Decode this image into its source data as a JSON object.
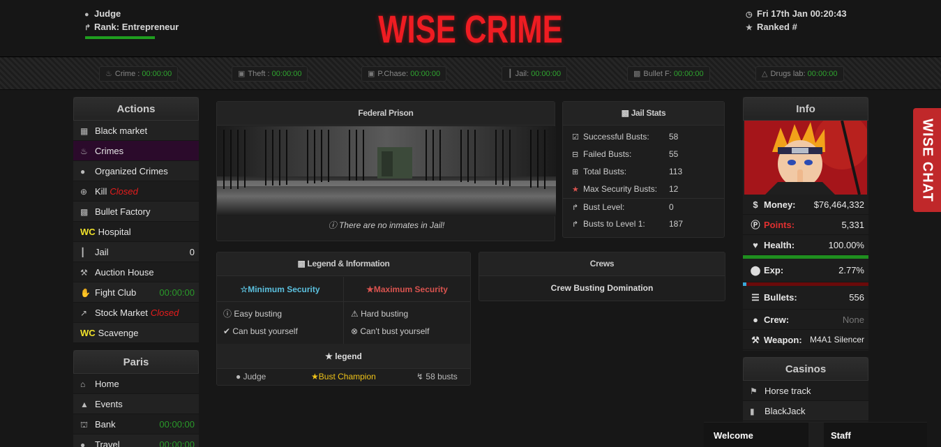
{
  "header": {
    "username": "Judge",
    "rank": "Rank: Entrepreneur",
    "logo": "WISE CRIME",
    "datetime": "Fri 17th Jan 00:20:43",
    "ranked": "Ranked #",
    "hp_fraction": 1.0,
    "logo_color": "#ef1c22"
  },
  "timers": [
    {
      "label": "Crime : ",
      "value": "00:00:00",
      "icon": "fire-icon"
    },
    {
      "label": "Theft : ",
      "value": "00:00:00",
      "icon": "car-icon"
    },
    {
      "label": "P.Chase: ",
      "value": "00:00:00",
      "icon": "car-icon"
    },
    {
      "label": "Jail: ",
      "value": "00:00:00",
      "icon": "bars-icon"
    },
    {
      "label": "Bullet F: ",
      "value": "00:00:00",
      "icon": "factory-icon"
    },
    {
      "label": "Drugs lab: ",
      "value": "00:00:00",
      "icon": "flask-icon"
    }
  ],
  "actions": {
    "title": "Actions",
    "items": [
      {
        "label": "Black market",
        "icon": "shop-icon"
      },
      {
        "label": "Crimes",
        "icon": "fire-icon",
        "active": true
      },
      {
        "label": "Organized Crimes",
        "icon": "users-icon"
      },
      {
        "label": "Kill",
        "icon": "crosshair-icon",
        "status": "Closed"
      },
      {
        "label": "Bullet Factory",
        "icon": "factory-icon"
      },
      {
        "label": "Hospital",
        "prefix": "WC"
      },
      {
        "label": "Jail",
        "icon": "bars-icon",
        "right": "0"
      },
      {
        "label": "Auction House",
        "icon": "gavel-icon"
      },
      {
        "label": "Fight Club",
        "icon": "fist-icon",
        "timer": "00:00:00"
      },
      {
        "label": "Stock Market",
        "icon": "chart-icon",
        "status": "Closed"
      },
      {
        "label": "Scavenge",
        "prefix": "WC"
      }
    ]
  },
  "city": {
    "title": "Paris",
    "items": [
      {
        "label": "Home",
        "icon": "home-icon"
      },
      {
        "label": "Events",
        "icon": "bell-icon"
      },
      {
        "label": "Bank",
        "icon": "bank-icon",
        "timer": "00:00:00"
      },
      {
        "label": "Travel",
        "icon": "globe-icon",
        "timer": "00:00:00"
      }
    ]
  },
  "prison": {
    "title": "Federal Prison",
    "note": "There are no inmates in Jail!"
  },
  "jail_stats": {
    "title": "Jail Stats",
    "rows": [
      {
        "label": "Successful Busts:",
        "value": "58",
        "icon": "check-square-icon"
      },
      {
        "label": "Failed Busts:",
        "value": "55",
        "icon": "minus-square-icon"
      },
      {
        "label": "Total Busts:",
        "value": "113",
        "icon": "plus-square-icon"
      },
      {
        "label": "Max Security Busts:",
        "value": "12",
        "icon": "star-icon"
      },
      {
        "label": "Bust Level:",
        "value": "0",
        "icon": "level-up-icon"
      },
      {
        "label": "Busts to Level 1:",
        "value": "187",
        "icon": "level-up-icon"
      }
    ]
  },
  "legend": {
    "title": "Legend & Information",
    "min_title": "Minimum Security",
    "max_title": "Maximum Security",
    "min_items": [
      "Easy busting",
      "Can bust yourself"
    ],
    "max_items": [
      "Hard busting",
      "Can't bust yourself"
    ],
    "legend_title": "legend",
    "champion_name": "Judge",
    "champion_label": "Bust Champion",
    "champion_busts": "58 busts"
  },
  "crews": {
    "title": "Crews",
    "subtitle": "Crew Busting Domination"
  },
  "info": {
    "title": "Info",
    "money_label": "Money:",
    "money": "$76,464,332",
    "points_label": "Points:",
    "points": "5,331",
    "health_label": "Health:",
    "health": "100.00%",
    "health_fraction": 1.0,
    "exp_label": "Exp:",
    "exp": "2.77%",
    "exp_fraction": 0.0277,
    "bullets_label": "Bullets:",
    "bullets": "556",
    "crew_label": "Crew:",
    "crew": "None",
    "weapon_label": "Weapon:",
    "weapon": "M4A1 Silencer"
  },
  "casinos": {
    "title": "Casinos",
    "items": [
      {
        "label": "Horse track",
        "icon": "flag-icon"
      },
      {
        "label": "BlackJack",
        "icon": "card-icon"
      }
    ]
  },
  "chat": {
    "label": "WISE CHAT"
  },
  "bottom": {
    "welcome": "Welcome",
    "staff": "Staff"
  }
}
